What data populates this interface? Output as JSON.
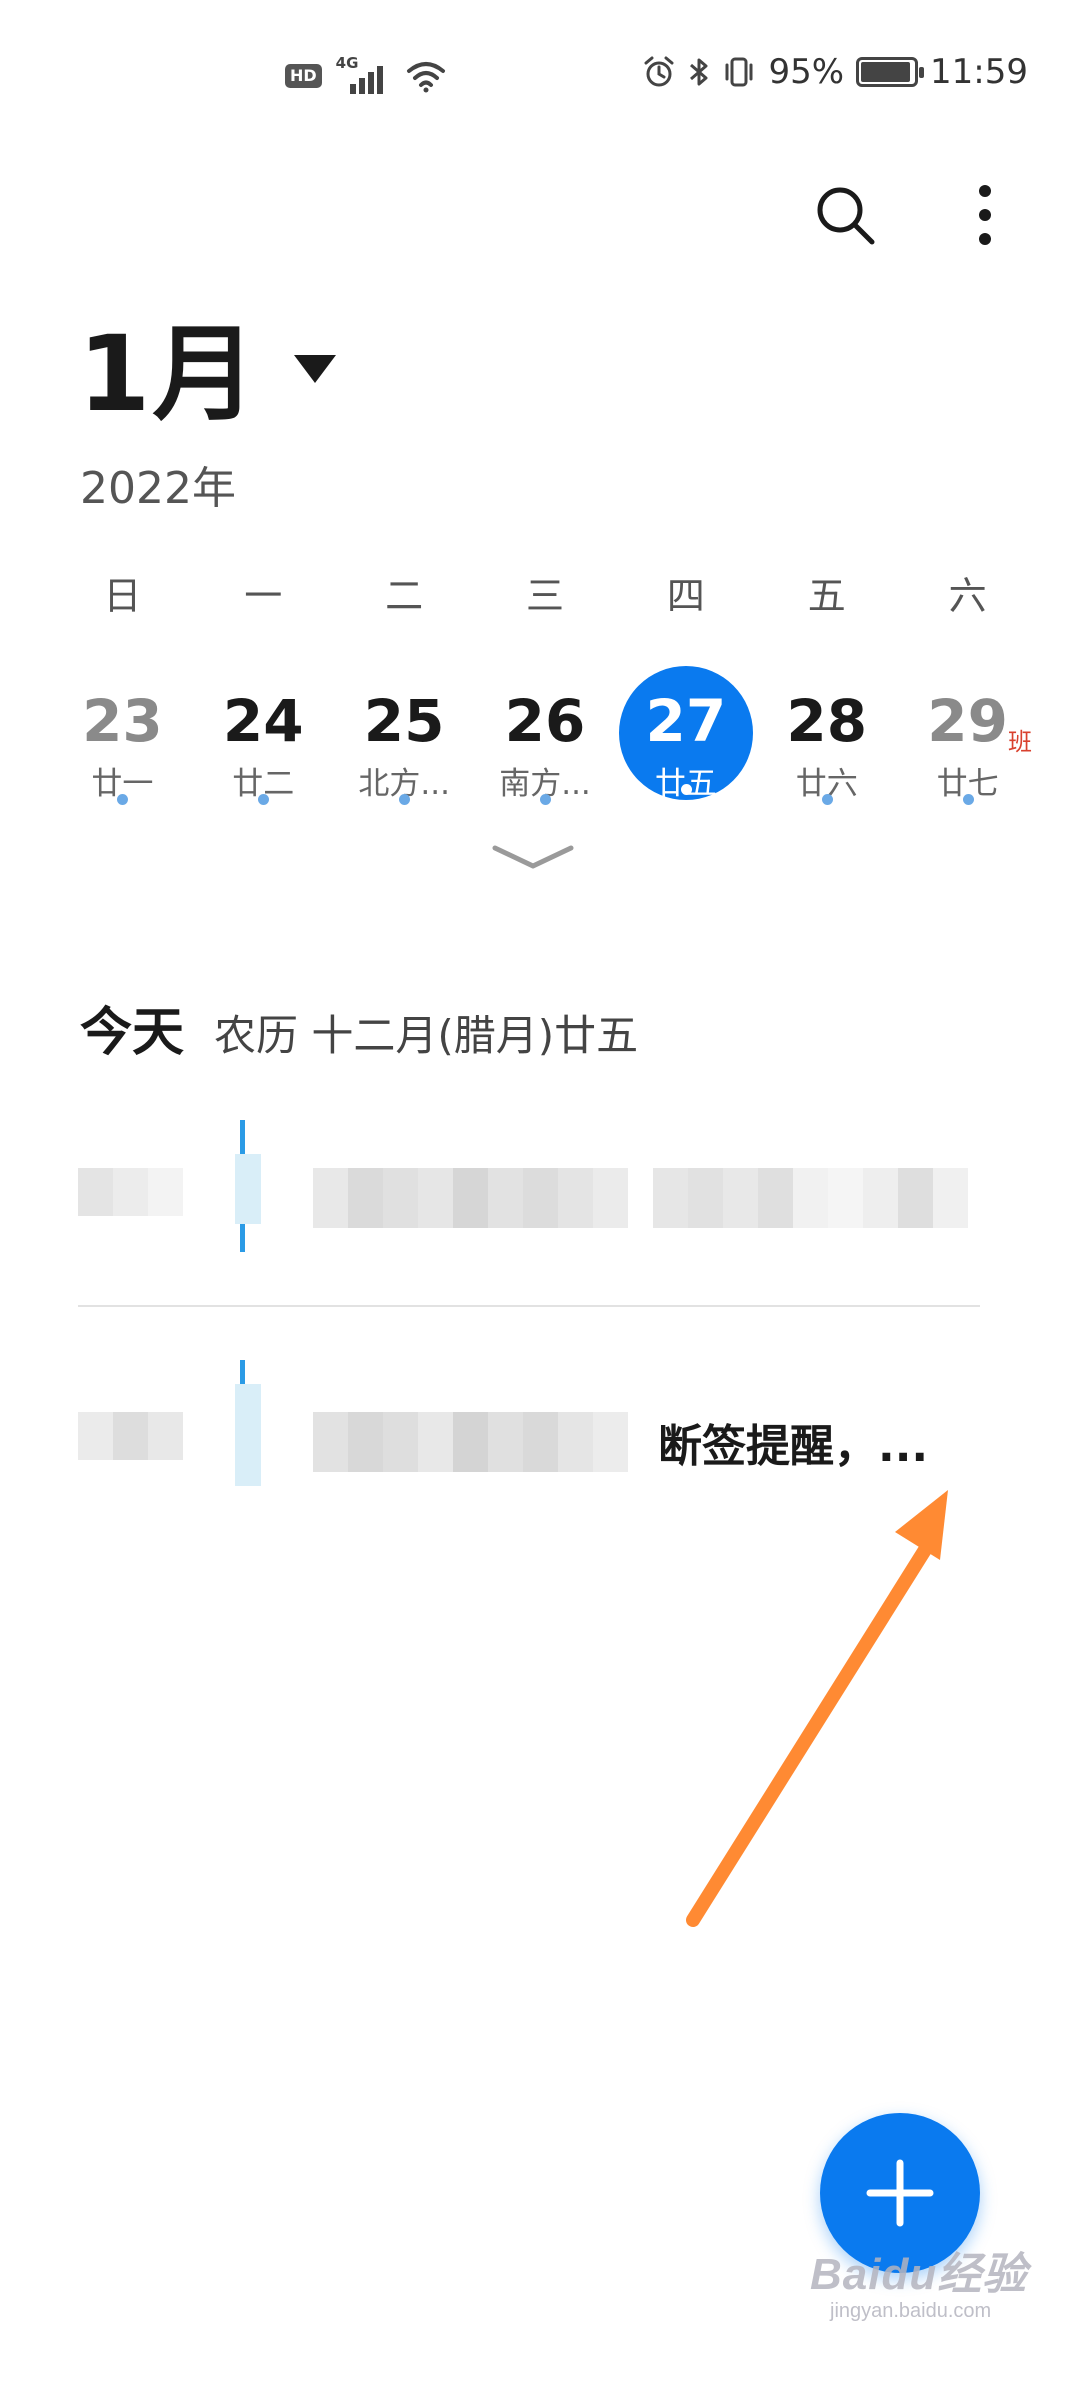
{
  "status_bar": {
    "hd": "HD",
    "network": "4G",
    "battery_percent": "95%",
    "battery_level": 0.95,
    "time": "11:59",
    "icons": [
      "hd-icon",
      "signal-icon",
      "wifi-icon",
      "alarm-icon",
      "bluetooth-icon",
      "vibrate-icon",
      "battery-icon"
    ]
  },
  "toolbar": {
    "icons": [
      "search-icon",
      "more-vert-icon"
    ]
  },
  "header": {
    "month": "1月",
    "year": "2022年"
  },
  "week": {
    "headers": [
      "日",
      "一",
      "二",
      "三",
      "四",
      "五",
      "六"
    ],
    "days": [
      {
        "num": "23",
        "lunar": "廿一"
      },
      {
        "num": "24",
        "lunar": "廿二"
      },
      {
        "num": "25",
        "lunar": "北方..."
      },
      {
        "num": "26",
        "lunar": "南方..."
      },
      {
        "num": "27",
        "lunar": "廿五"
      },
      {
        "num": "28",
        "lunar": "廿六"
      },
      {
        "num": "29",
        "lunar": "廿七",
        "badge": "班"
      }
    ]
  },
  "today": {
    "title": "今天",
    "lunar": "农历 十二月(腊月)廿五"
  },
  "events": [
    {
      "title_visible": ""
    },
    {
      "title_visible": "断签提醒，..."
    }
  ],
  "colors": {
    "accent": "#0a7aef",
    "event_bar": "#2b9be6",
    "annotation_arrow": "#ff8a33",
    "workday_badge": "#d9412e"
  },
  "watermark": {
    "main": "Baidu经验",
    "sub": "jingyan.baidu.com"
  }
}
